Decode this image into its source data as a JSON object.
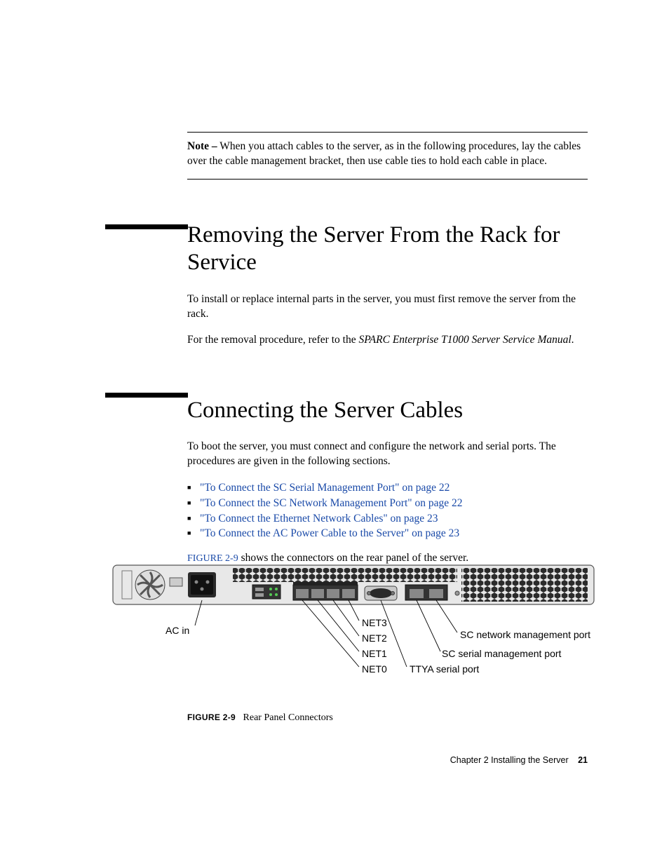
{
  "note": {
    "label": "Note –",
    "text": " When you attach cables to the server, as in the following procedures, lay the cables over the cable management bracket, then use cable ties to hold each cable in place."
  },
  "section1": {
    "heading": "Removing the Server From the Rack for Service",
    "p1": "To install or replace internal parts in the server, you must first remove the server from the rack.",
    "p2_a": "For the removal procedure, refer to the ",
    "p2_i": "SPARC Enterprise T1000 Server Service Manual",
    "p2_b": "."
  },
  "section2": {
    "heading": "Connecting the Server Cables",
    "p1": "To boot the server, you must connect and configure the network and serial ports. The procedures are given in the following sections.",
    "links": [
      "\"To Connect the SC Serial Management Port\" on page 22",
      "\"To Connect the SC Network Management Port\" on page 22",
      "\"To Connect the Ethernet Network Cables\" on page 23",
      "\"To Connect the AC Power Cable to the Server\" on page 23"
    ],
    "figref": "FIGURE 2-9",
    "figref_tail": " shows the connectors on the rear panel of the server."
  },
  "figure": {
    "callouts": {
      "ac": "AC in",
      "net3": "NET3",
      "net2": "NET2",
      "net1": "NET1",
      "net0": "NET0",
      "ttya": "TTYA serial port",
      "sc_serial": "SC serial management port",
      "sc_net": "SC network management port"
    },
    "caption_label": "FIGURE 2-9",
    "caption_text": "Rear Panel Connectors"
  },
  "footer": {
    "chapter": "Chapter 2    Installing the Server",
    "page": "21"
  }
}
